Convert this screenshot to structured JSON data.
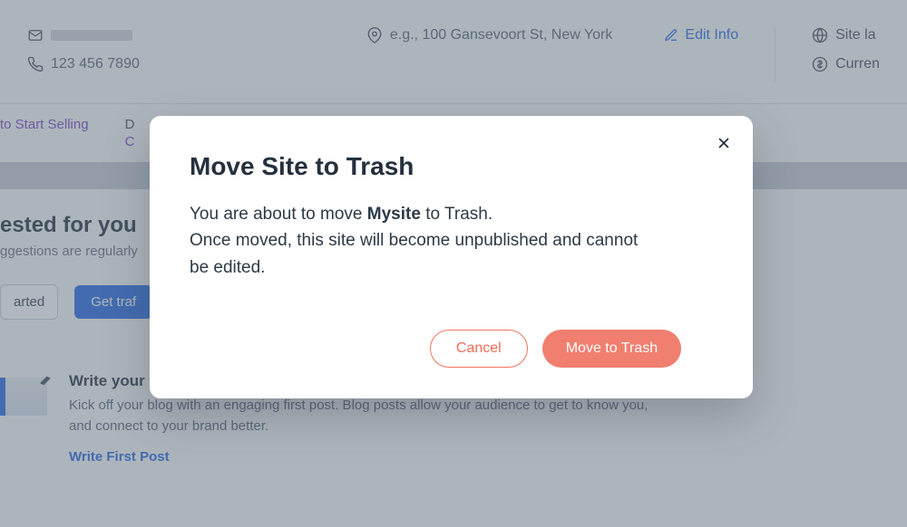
{
  "business_info": {
    "phone": "123 456 7890",
    "address_placeholder": "e.g., 100 Gansevoort St, New York",
    "edit_label": "Edit Info",
    "site_language_label": "Site la",
    "currency_label": "Curren"
  },
  "sections": {
    "start_selling": "to Start Selling",
    "letter": "D"
  },
  "suggested": {
    "heading": "ested for you",
    "sub": "ggestions are regularly"
  },
  "buttons": {
    "started": "arted",
    "get_traffic": "Get traf"
  },
  "card": {
    "title": "Write your first blog post",
    "body": "Kick off your blog with an engaging first post. Blog posts allow your audience to get to know you, and connect to your brand better.",
    "link": "Write First Post"
  },
  "modal": {
    "title": "Move Site to Trash",
    "line1_pre": "You are about to move ",
    "line1_name": "Mysite",
    "line1_post": " to Trash.",
    "line2": "Once moved, this site will become unpublished and cannot be edited.",
    "cancel": "Cancel",
    "confirm": "Move to Trash"
  }
}
